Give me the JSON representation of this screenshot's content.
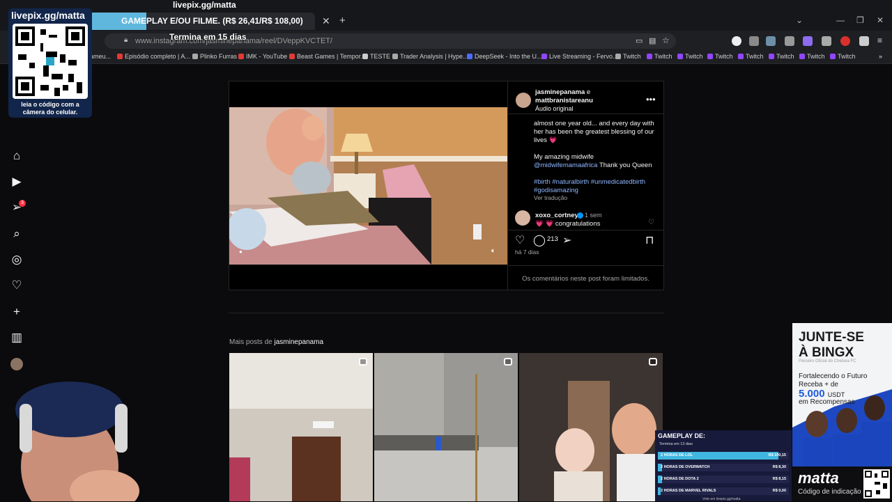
{
  "stream_overlay": {
    "livepix_url": "livepix.gg/matta",
    "top_label": "livepix.gg/matta",
    "qr_caption": "leia o código com a câmera do celular.",
    "goal_text": "GAMEPLAY E/OU FILME. (R$ 26,41/R$ 108,00)",
    "termina": "Termina em 15 dias",
    "goal_progress": 0.2445
  },
  "browser": {
    "address": "www.instagram.com/jasminepanama/reel/DVeppKVCTET/",
    "bookmarks": [
      {
        "label": "ameu...",
        "color": "#d32f2f"
      },
      {
        "label": "Episódio completo | A...",
        "color": "#e53935"
      },
      {
        "label": "Plinko Furras",
        "color": "#aaaaaa"
      },
      {
        "label": "IMK - YouTube",
        "color": "#e53935"
      },
      {
        "label": "Beast Games | Tempor...",
        "color": "#e53935"
      },
      {
        "label": "TESTE",
        "color": "#cccccc"
      },
      {
        "label": "Trader Analysis | Hype...",
        "color": "#aaaaaa"
      },
      {
        "label": "DeepSeek - Into the U...",
        "color": "#4e6cff"
      },
      {
        "label": "Live Streaming - Fervo...",
        "color": "#9146ff"
      },
      {
        "label": "Twitch",
        "color": "#aaaaaa"
      },
      {
        "label": "Twitch",
        "color": "#9146ff"
      },
      {
        "label": "Twitch",
        "color": "#9146ff"
      },
      {
        "label": "Twitch",
        "color": "#9146ff"
      },
      {
        "label": "Twitch",
        "color": "#9146ff"
      },
      {
        "label": "Twitch",
        "color": "#9146ff"
      },
      {
        "label": "Twitch",
        "color": "#9146ff"
      },
      {
        "label": "Twitch",
        "color": "#9146ff"
      }
    ]
  },
  "post": {
    "authors_user1": "jasminepanama",
    "authors_and": " e",
    "authors_user2": "mattbranistareanu",
    "audio": "Áudio original",
    "caption_line1": "almost one year old... and every day with her has been the greatest blessing of our lives 💗",
    "caption_line2": "My amazing midwife",
    "midwife_tag": "@midwifemamaafrica",
    "caption_thanks": " Thank you Queen",
    "hashtags": "#birth #naturalbirth #unmedicatedbirth #godisamazing",
    "translate": "Ver tradução",
    "comment_user": "xoxo_cortney",
    "comment_time": "1 sem",
    "comment_text": "💗 💗 congratulations",
    "comments_count": "213",
    "time_ago": "há 7 dias",
    "comments_limited": "Os comentários neste post foram limitados."
  },
  "more_posts": {
    "prefix": "Mais posts de",
    "user": "jasminepanama"
  },
  "ad": {
    "headline": "JUNTE-SE À BINGX",
    "partner": "Parceiro Oficial do Chelsea FC",
    "line1": "Fortalecendo o Futuro",
    "line2": "Receba + de",
    "amount": "5.000",
    "currency": "USDT",
    "line3": "em Recompensas",
    "brand": "matta",
    "brand_sub": "Código de indicação"
  },
  "gameplay": {
    "title": "GAMEPLAY DE:",
    "subtitle": "Termina em 13 dias",
    "items": [
      {
        "name": "2 HORAS DE LOL",
        "value": "R$ 100,15",
        "progress": 0.92
      },
      {
        "name": "2 HORAS DE OVERWATCH",
        "value": "R$ 8,30",
        "progress": 0.03
      },
      {
        "name": "2 HORAS DE DOTA 2",
        "value": "R$ 8,15",
        "progress": 0.03
      },
      {
        "name": "2 HORAS DE MARVEL RIVALS",
        "value": "R$ 0,00",
        "progress": 0.0
      }
    ],
    "footer": "Vote em livepix.gg/matta"
  }
}
